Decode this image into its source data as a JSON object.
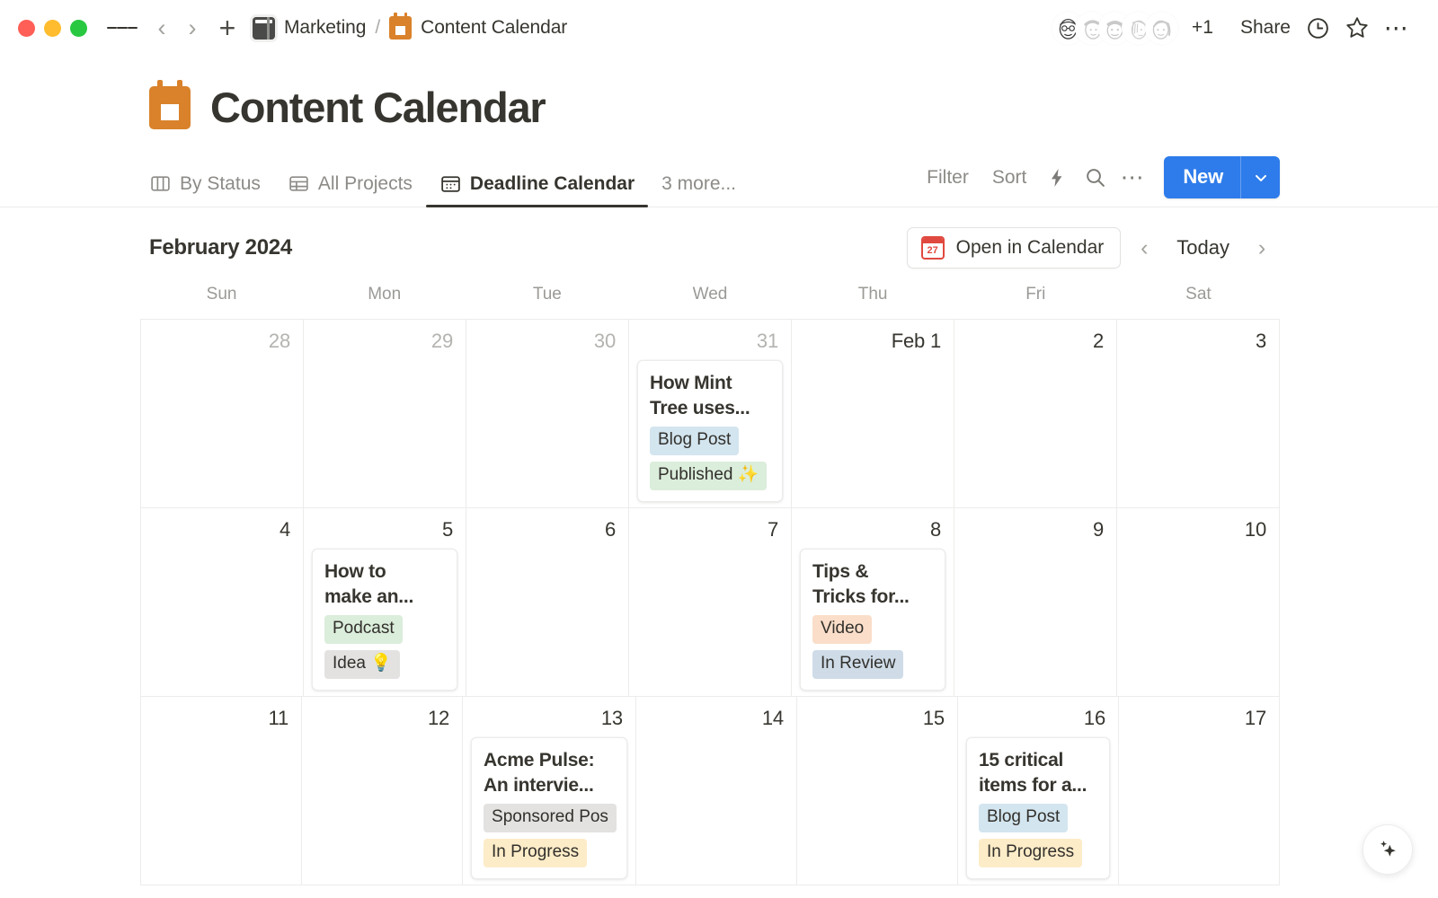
{
  "titlebar": {
    "breadcrumb": [
      {
        "icon": "notebook-icon",
        "label": "Marketing"
      },
      {
        "icon": "calendar-orange-icon",
        "label": "Content Calendar"
      }
    ],
    "separator": "/",
    "overflow_members": "+1",
    "share_label": "Share",
    "icons": [
      "hamburger-icon",
      "back-chevron-icon",
      "forward-chevron-icon",
      "plus-icon",
      "history-clock-icon",
      "star-icon",
      "more-options-icon"
    ],
    "window_controls": [
      "close",
      "minimize",
      "zoom"
    ]
  },
  "page": {
    "title": "Content Calendar",
    "title_icon": "calendar-orange-icon"
  },
  "views": {
    "tabs": [
      {
        "label": "By Status",
        "icon": "board-icon",
        "active": false
      },
      {
        "label": "All Projects",
        "icon": "table-icon",
        "active": false
      },
      {
        "label": "Deadline Calendar",
        "icon": "calendar-icon",
        "active": true
      }
    ],
    "more_label": "3 more...",
    "filter_label": "Filter",
    "sort_label": "Sort",
    "automation_icon": "lightning-icon",
    "search_icon": "search-icon",
    "more_icon": "more-options-icon",
    "new_label": "New",
    "new_dropdown_icon": "chevron-down-icon",
    "accent_color": "#2e7ceb"
  },
  "calendar": {
    "month_label": "February 2024",
    "open_in_calendar_label": "Open in Calendar",
    "open_in_calendar_icon": "calendar-27-icon",
    "calendar_icon_number": "27",
    "prev_label": "‹",
    "today_label": "Today",
    "next_label": "›",
    "day_headers": [
      "Sun",
      "Mon",
      "Tue",
      "Wed",
      "Thu",
      "Fri",
      "Sat"
    ],
    "weeks": [
      {
        "days": [
          {
            "num": "28",
            "muted": true,
            "events": []
          },
          {
            "num": "29",
            "muted": true,
            "events": []
          },
          {
            "num": "30",
            "muted": true,
            "events": []
          },
          {
            "num": "31",
            "muted": true,
            "events": [
              {
                "title_lines": [
                  "How Mint",
                  "Tree uses..."
                ],
                "tags": [
                  {
                    "text": "Blog Post",
                    "color": "blue"
                  },
                  {
                    "text": "Published ✨",
                    "color": "green"
                  }
                ]
              }
            ]
          },
          {
            "num": "Feb 1",
            "muted": false,
            "events": []
          },
          {
            "num": "2",
            "muted": false,
            "events": []
          },
          {
            "num": "3",
            "muted": false,
            "events": []
          }
        ]
      },
      {
        "days": [
          {
            "num": "4",
            "muted": false,
            "events": []
          },
          {
            "num": "5",
            "muted": false,
            "events": [
              {
                "title_lines": [
                  "How to",
                  "make an..."
                ],
                "tags": [
                  {
                    "text": "Podcast",
                    "color": "green"
                  },
                  {
                    "text": "Idea 💡",
                    "color": "gray"
                  }
                ]
              }
            ]
          },
          {
            "num": "6",
            "muted": false,
            "events": []
          },
          {
            "num": "7",
            "muted": false,
            "events": []
          },
          {
            "num": "8",
            "muted": false,
            "events": [
              {
                "title_lines": [
                  "Tips &",
                  "Tricks for..."
                ],
                "tags": [
                  {
                    "text": "Video",
                    "color": "orange"
                  },
                  {
                    "text": "In Review",
                    "color": "bluegray"
                  }
                ]
              }
            ]
          },
          {
            "num": "9",
            "muted": false,
            "events": []
          },
          {
            "num": "10",
            "muted": false,
            "events": []
          }
        ]
      },
      {
        "days": [
          {
            "num": "11",
            "muted": false,
            "events": []
          },
          {
            "num": "12",
            "muted": false,
            "events": []
          },
          {
            "num": "13",
            "muted": false,
            "events": [
              {
                "title_lines": [
                  "Acme Pulse:",
                  "An intervie..."
                ],
                "tags": [
                  {
                    "text": "Sponsored Pos",
                    "color": "gray"
                  },
                  {
                    "text": "In Progress",
                    "color": "yellow"
                  }
                ]
              }
            ]
          },
          {
            "num": "14",
            "muted": false,
            "events": []
          },
          {
            "num": "15",
            "muted": false,
            "events": []
          },
          {
            "num": "16",
            "muted": false,
            "events": [
              {
                "title_lines": [
                  "15 critical",
                  "items for a..."
                ],
                "tags": [
                  {
                    "text": "Blog Post",
                    "color": "blue"
                  },
                  {
                    "text": "In Progress",
                    "color": "yellow"
                  }
                ]
              }
            ]
          },
          {
            "num": "17",
            "muted": false,
            "events": []
          }
        ]
      }
    ]
  },
  "fab": {
    "icon": "sparkles-ai-icon"
  }
}
